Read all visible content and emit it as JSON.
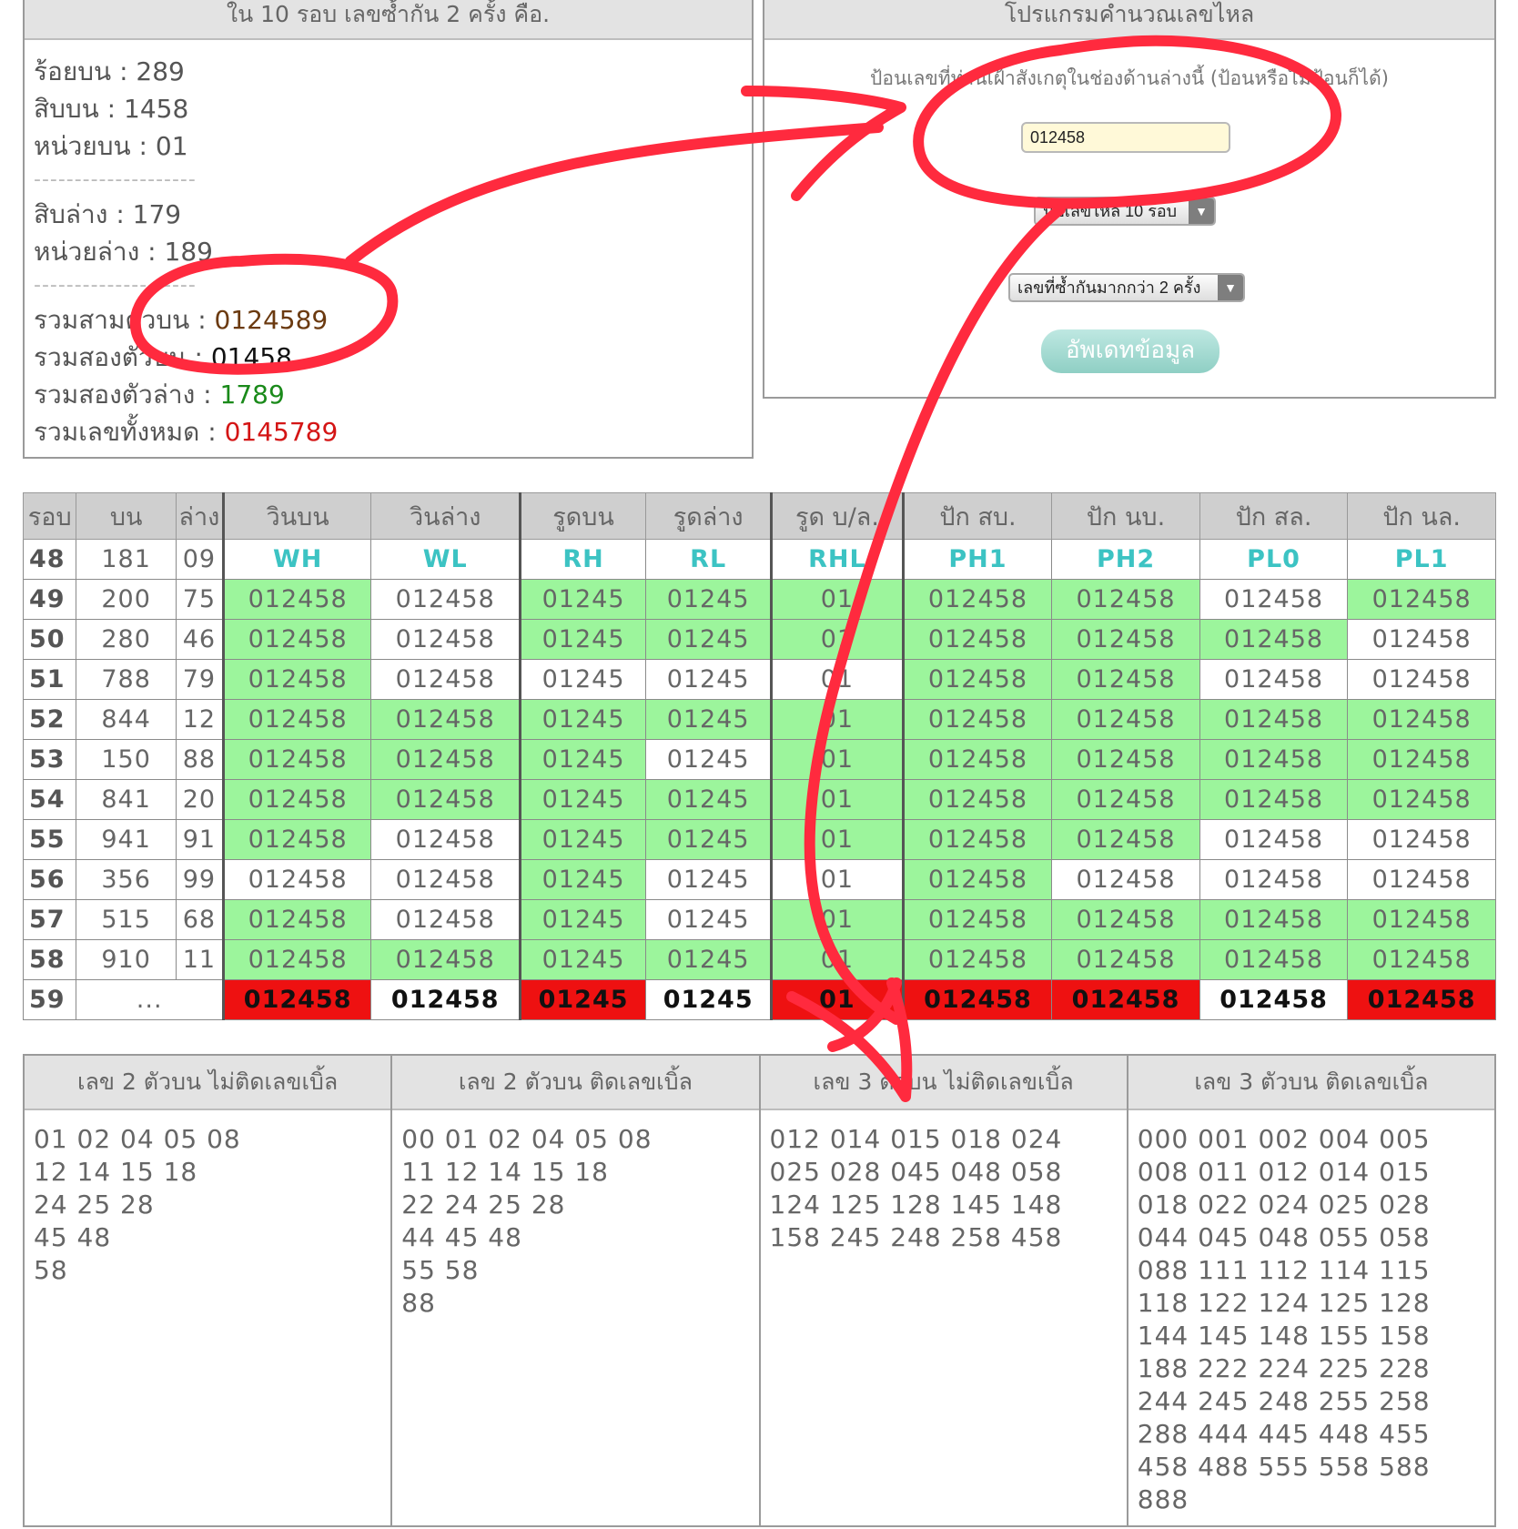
{
  "summary": {
    "title": "ใน 10 รอบ เลขซ้ำกัน 2 ครั้ง คือ.",
    "hundreds_top": "ร้อยบน : 289",
    "tens_top": "สิบบน : 1458",
    "units_top": "หน่วยบน : 01",
    "separator": "--------------------",
    "tens_bottom": "สิบล่าง : 179",
    "units_bottom": "หน่วยล่าง : 189",
    "sum3_top_label": "รวมสามตัวบน : ",
    "sum3_top_value": "0124589",
    "sum2_top_label": "รวมสองตัวบน : ",
    "sum2_top_value": "01458",
    "sum2_bottom_label": "รวมสองตัวล่าง : ",
    "sum2_bottom_value": "1789",
    "sum_all_label": "รวมเลขทั้งหมด : ",
    "sum_all_value": "0145789",
    "colors": {
      "sum3": "#6b3a10",
      "sum2": "#111111",
      "sum2_bottom": "#1a8a1a",
      "sum_all": "#d41515"
    }
  },
  "calculator": {
    "title": "โปรแกรมคำนวณเลขไหล",
    "prompt": "ป้อนเลขที่ท่านเฝ้าสังเกตุในช่องด้านล่างนี้ (ป้อนหรือไม่ป้อนก็ได้)",
    "input_value": "012458",
    "rounds_select": "นับเลขไหล 10 รอบ",
    "repeat_select": "เลขที่ซ้ำกันมากกว่า 2 ครั้ง",
    "update_label": "อัพเดทข้อมูล"
  },
  "table": {
    "headers": [
      "รอบ",
      "บน",
      "ล่าง",
      "วินบน",
      "วินล่าง",
      "รูดบน",
      "รูดล่าง",
      "รูด บ/ล.",
      "ปัก สบ.",
      "ปัก นบ.",
      "ปัก สล.",
      "ปัก นล."
    ],
    "code_row": {
      "round": "48",
      "top": "181",
      "bottom": "09",
      "codes": [
        "WH",
        "WL",
        "RH",
        "RL",
        "RHL",
        "PH1",
        "PH2",
        "PL0",
        "PL1"
      ]
    },
    "rows": [
      {
        "round": "49",
        "top": "200",
        "bottom": "75",
        "cells": [
          "012458",
          "012458",
          "01245",
          "01245",
          "01",
          "012458",
          "012458",
          "012458",
          "012458"
        ],
        "hits": [
          1,
          0,
          1,
          1,
          1,
          1,
          1,
          0,
          1
        ]
      },
      {
        "round": "50",
        "top": "280",
        "bottom": "46",
        "cells": [
          "012458",
          "012458",
          "01245",
          "01245",
          "01",
          "012458",
          "012458",
          "012458",
          "012458"
        ],
        "hits": [
          1,
          0,
          1,
          1,
          1,
          1,
          1,
          1,
          0
        ]
      },
      {
        "round": "51",
        "top": "788",
        "bottom": "79",
        "cells": [
          "012458",
          "012458",
          "01245",
          "01245",
          "01",
          "012458",
          "012458",
          "012458",
          "012458"
        ],
        "hits": [
          1,
          0,
          0,
          0,
          0,
          1,
          1,
          0,
          0
        ]
      },
      {
        "round": "52",
        "top": "844",
        "bottom": "12",
        "cells": [
          "012458",
          "012458",
          "01245",
          "01245",
          "01",
          "012458",
          "012458",
          "012458",
          "012458"
        ],
        "hits": [
          1,
          1,
          1,
          1,
          1,
          1,
          1,
          1,
          1
        ]
      },
      {
        "round": "53",
        "top": "150",
        "bottom": "88",
        "cells": [
          "012458",
          "012458",
          "01245",
          "01245",
          "01",
          "012458",
          "012458",
          "012458",
          "012458"
        ],
        "hits": [
          1,
          1,
          1,
          0,
          1,
          1,
          1,
          1,
          1
        ]
      },
      {
        "round": "54",
        "top": "841",
        "bottom": "20",
        "cells": [
          "012458",
          "012458",
          "01245",
          "01245",
          "01",
          "012458",
          "012458",
          "012458",
          "012458"
        ],
        "hits": [
          1,
          1,
          1,
          1,
          1,
          1,
          1,
          1,
          1
        ]
      },
      {
        "round": "55",
        "top": "941",
        "bottom": "91",
        "cells": [
          "012458",
          "012458",
          "01245",
          "01245",
          "01",
          "012458",
          "012458",
          "012458",
          "012458"
        ],
        "hits": [
          1,
          0,
          1,
          1,
          1,
          1,
          1,
          0,
          0
        ]
      },
      {
        "round": "56",
        "top": "356",
        "bottom": "99",
        "cells": [
          "012458",
          "012458",
          "01245",
          "01245",
          "01",
          "012458",
          "012458",
          "012458",
          "012458"
        ],
        "hits": [
          0,
          0,
          1,
          0,
          0,
          1,
          0,
          0,
          0
        ]
      },
      {
        "round": "57",
        "top": "515",
        "bottom": "68",
        "cells": [
          "012458",
          "012458",
          "01245",
          "01245",
          "01",
          "012458",
          "012458",
          "012458",
          "012458"
        ],
        "hits": [
          1,
          0,
          1,
          0,
          1,
          1,
          1,
          1,
          1
        ]
      },
      {
        "round": "58",
        "top": "910",
        "bottom": "11",
        "cells": [
          "012458",
          "012458",
          "01245",
          "01245",
          "01",
          "012458",
          "012458",
          "012458",
          "012458"
        ],
        "hits": [
          1,
          1,
          1,
          1,
          1,
          1,
          1,
          1,
          1
        ]
      }
    ],
    "next_row": {
      "round": "59",
      "top": "...",
      "cells": [
        "012458",
        "012458",
        "01245",
        "01245",
        "01",
        "012458",
        "012458",
        "012458",
        "012458"
      ],
      "red": [
        1,
        0,
        1,
        0,
        1,
        1,
        1,
        0,
        1
      ]
    },
    "colors": {
      "hit": "#9cf59c",
      "red": "#ee1111",
      "code": "#3cc3c3"
    }
  },
  "lists": [
    {
      "title": "เลข 2 ตัวบน ไม่ติดเลขเบิ้ล",
      "lines": [
        "01 02 04 05 08",
        "12 14 15 18",
        "24 25 28",
        "45 48",
        "58"
      ]
    },
    {
      "title": "เลข 2 ตัวบน ติดเลขเบิ้ล",
      "lines": [
        "00 01 02 04 05 08",
        "11 12 14 15 18",
        "22 24 25 28",
        "44 45 48",
        "55 58",
        "88"
      ]
    },
    {
      "title": "เลข 3 ตัวบน ไม่ติดเลขเบิ้ล",
      "lines": [
        "012 014 015 018 024",
        "025 028 045 048 058",
        "124 125 128 145 148",
        "158 245 248 258 458"
      ]
    },
    {
      "title": "เลข 3 ตัวบน ติดเลขเบิ้ล",
      "lines": [
        "000 001 002 004 005",
        "008 011 012 014 015",
        "018 022 024 025 028",
        "044 045 048 055 058",
        "088 111 112 114 115",
        "118 122 124 125 128",
        "144 145 148 155 158",
        "188 222 224 225 228",
        "244 245 248 255 258",
        "288 444 445 448 455",
        "458 488 555 558 588",
        "888"
      ]
    }
  ],
  "annotation_color": "#ff2a3e"
}
